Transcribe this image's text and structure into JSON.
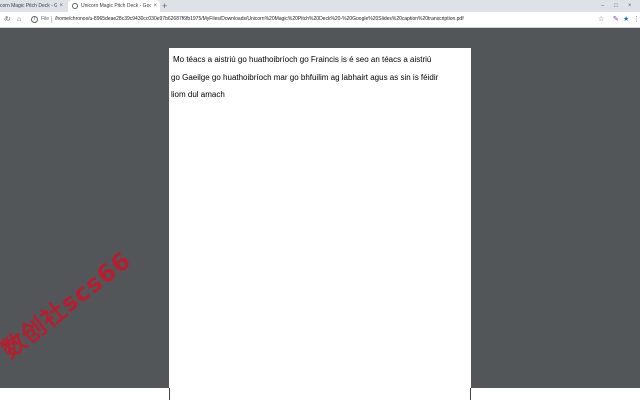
{
  "tabs": [
    {
      "title": "corn Magic Pitch Deck - Goo...",
      "close": "×"
    },
    {
      "title": "Unicorn Magic Pitch Deck - Goo...",
      "close": "×"
    }
  ],
  "new_tab": "+",
  "window": {
    "minimize": "–",
    "maximize": "□",
    "close": "×"
  },
  "toolbar": {
    "back": "‹",
    "reload": "↻",
    "home": "⌂",
    "info": "i",
    "file_label": "File",
    "url": "/home/chronos/u-8965deae28c39c9430cc030e97b62687f6fb1975/MyFiles/Downloads/Unicorn%20Magic%20Pitch%20Deck%20-%20Google%20Slides%20caption%20transcription.pdf",
    "star": "☆",
    "ext1": "✎",
    "ext2": "★",
    "menu": "⋮"
  },
  "document": {
    "lines": [
      " Mo téacs a aistriú go huathoibríoch go Fraincis is é seo an téacs a aistriú",
      "go Gaeilge go huathoibríoch mar go bhfuilim ag labhairt agus as sin is féidir",
      "liom dul amach"
    ]
  },
  "watermark": "数创社scs66",
  "colors": {
    "viewer_bg": "#525659",
    "tabstrip": "#dee1e6",
    "watermark": "#c0192b"
  }
}
